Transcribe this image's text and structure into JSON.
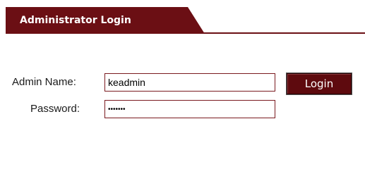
{
  "header": {
    "tab_title": "Administrator Login"
  },
  "form": {
    "admin_name_label": "Admin Name:",
    "admin_name_value": "keadmin",
    "password_label": "Password:",
    "password_value": "•••••••",
    "login_button_label": "Login"
  },
  "colors": {
    "brand_maroon": "#6b0f14",
    "button_fill": "#5e0a0e",
    "text": "#1a1a1a"
  }
}
